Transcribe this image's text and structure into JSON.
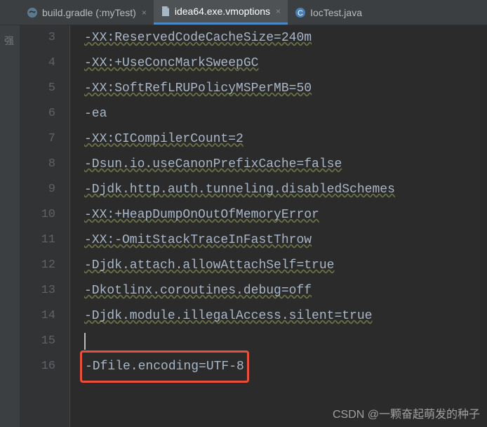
{
  "tabs": [
    {
      "label": "build.gradle (:myTest)",
      "active": false,
      "icon": "gradle"
    },
    {
      "label": "idea64.exe.vmoptions",
      "active": true,
      "icon": "file"
    },
    {
      "label": "IocTest.java",
      "active": false,
      "icon": "class"
    }
  ],
  "lines": [
    {
      "number": "3",
      "text": "-XX:ReservedCodeCacheSize=240m"
    },
    {
      "number": "4",
      "text": "-XX:+UseConcMarkSweepGC"
    },
    {
      "number": "5",
      "text": "-XX:SoftRefLRUPolicyMSPerMB=50"
    },
    {
      "number": "6",
      "text": "-ea"
    },
    {
      "number": "7",
      "text": "-XX:CICompilerCount=2"
    },
    {
      "number": "8",
      "text": "-Dsun.io.useCanonPrefixCache=false"
    },
    {
      "number": "9",
      "text": "-Djdk.http.auth.tunneling.disabledSchemes"
    },
    {
      "number": "10",
      "text": "-XX:+HeapDumpOnOutOfMemoryError"
    },
    {
      "number": "11",
      "text": "-XX:-OmitStackTraceInFastThrow"
    },
    {
      "number": "12",
      "text": "-Djdk.attach.allowAttachSelf=true"
    },
    {
      "number": "13",
      "text": "-Dkotlinx.coroutines.debug=off"
    },
    {
      "number": "14",
      "text": "-Djdk.module.illegalAccess.silent=true"
    },
    {
      "number": "15",
      "text": ""
    },
    {
      "number": "16",
      "text": "-Dfile.encoding=UTF-8",
      "highlighted": true
    }
  ],
  "watermark": "CSDN @一颗奋起萌发的种子",
  "sidebar_marker": "强"
}
